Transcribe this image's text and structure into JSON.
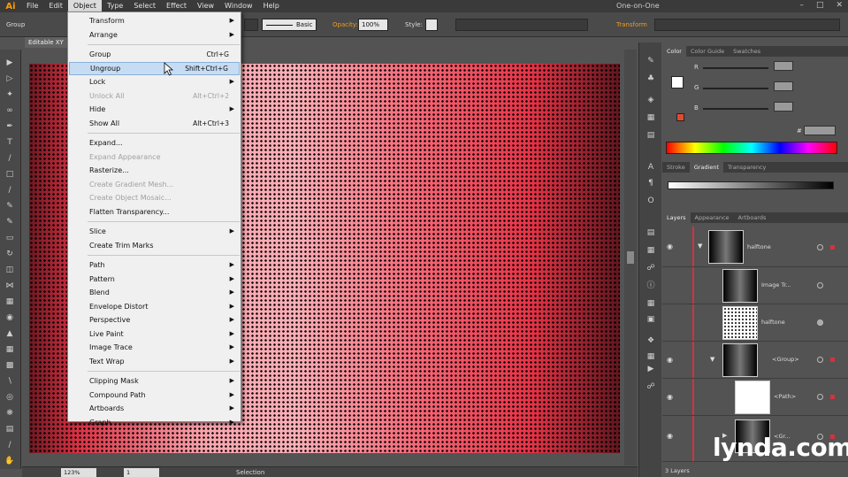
{
  "app": {
    "logo": "Ai",
    "workspace": "One-on-One"
  },
  "menubar": {
    "items": [
      "File",
      "Edit",
      "Object",
      "Type",
      "Select",
      "Effect",
      "View",
      "Window",
      "Help"
    ],
    "active": "Object"
  },
  "controlbar": {
    "group_label": "Group",
    "stroke_style": "Basic",
    "opacity_label": "Opacity:",
    "opacity_value": "100%",
    "style_label": "Style:",
    "transform_label": "Transform"
  },
  "document": {
    "tab_title": "Editable XY"
  },
  "statusbar": {
    "zoom": "123%",
    "artboard": "1",
    "status": "Selection"
  },
  "object_menu": [
    {
      "label": "Transform",
      "submenu": true
    },
    {
      "label": "Arrange",
      "submenu": true
    },
    {
      "sep": true
    },
    {
      "label": "Group",
      "shortcut": "Ctrl+G"
    },
    {
      "label": "Ungroup",
      "shortcut": "Shift+Ctrl+G",
      "highlighted": true
    },
    {
      "label": "Lock",
      "submenu": true
    },
    {
      "label": "Unlock All",
      "shortcut": "Alt+Ctrl+2",
      "disabled": true
    },
    {
      "label": "Hide",
      "submenu": true
    },
    {
      "label": "Show All",
      "shortcut": "Alt+Ctrl+3"
    },
    {
      "sep": true
    },
    {
      "label": "Expand..."
    },
    {
      "label": "Expand Appearance",
      "disabled": true
    },
    {
      "label": "Rasterize..."
    },
    {
      "label": "Create Gradient Mesh...",
      "disabled": true
    },
    {
      "label": "Create Object Mosaic...",
      "disabled": true
    },
    {
      "label": "Flatten Transparency..."
    },
    {
      "sep": true
    },
    {
      "label": "Slice",
      "submenu": true
    },
    {
      "label": "Create Trim Marks"
    },
    {
      "sep": true
    },
    {
      "label": "Path",
      "submenu": true
    },
    {
      "label": "Pattern",
      "submenu": true
    },
    {
      "label": "Blend",
      "submenu": true
    },
    {
      "label": "Envelope Distort",
      "submenu": true
    },
    {
      "label": "Perspective",
      "submenu": true
    },
    {
      "label": "Live Paint",
      "submenu": true
    },
    {
      "label": "Image Trace",
      "submenu": true
    },
    {
      "label": "Text Wrap",
      "submenu": true
    },
    {
      "sep": true
    },
    {
      "label": "Clipping Mask",
      "submenu": true
    },
    {
      "label": "Compound Path",
      "submenu": true
    },
    {
      "label": "Artboards",
      "submenu": true
    },
    {
      "label": "Graph",
      "submenu": true
    }
  ],
  "color_panel": {
    "tabs": [
      "Color",
      "Color Guide",
      "Swatches"
    ],
    "channels": [
      "R",
      "G",
      "B"
    ],
    "hex_prefix": "#",
    "accent": "#f1364a"
  },
  "gradient_panel": {
    "tabs": [
      "Stroke",
      "Gradient",
      "Transparency"
    ]
  },
  "layers_panel": {
    "tabs": [
      "Layers",
      "Appearance",
      "Artboards"
    ],
    "rows": [
      {
        "name": "halftone"
      },
      {
        "name": "Image Tr..."
      },
      {
        "name": "halftone"
      },
      {
        "name": "<Group>"
      },
      {
        "name": "<Path>"
      },
      {
        "name": "<Gr..."
      }
    ],
    "footer": "3 Layers"
  },
  "watermark": {
    "text_a": "lynda",
    "dot": ".",
    "text_b": "com"
  }
}
